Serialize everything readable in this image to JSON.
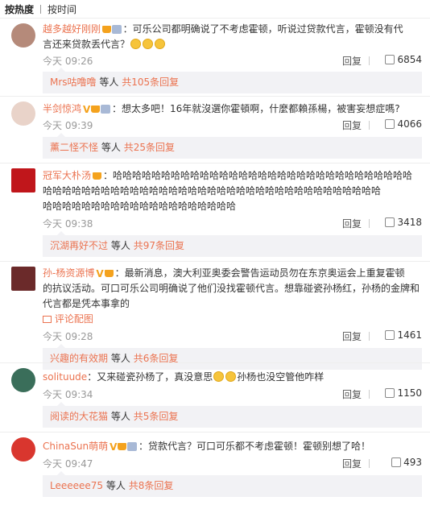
{
  "tabs": [
    "按热度",
    "按时间"
  ],
  "ui": {
    "reply": "回复",
    "mid": "等人",
    "gong": "共",
    "reply_count_suffix": "条回复"
  },
  "comments": [
    {
      "user": "越多越好刚刚",
      "text_a": "：可乐公司都明确说了不考虑霍顿，听说过贷款代言，霍顿没有代",
      "text_b": "言还来贷款丢代言？",
      "time": "今天 09:26",
      "likes": "6854",
      "sub_name": "Mrs咕噜噜",
      "sub_count": "105"
    },
    {
      "user": "半剑惊鸿",
      "text_a": "：想太多吧！16年就沒選你霍頓啊，什麼都賴孫楊，被害妄想症嗎?",
      "time": "今天 09:39",
      "likes": "4066",
      "sub_name": "薰二怪不怪",
      "sub_count": "25"
    },
    {
      "user": "冠军大朴汤",
      "text_a": "：哈哈哈哈哈哈哈哈哈哈哈哈哈哈哈哈哈哈哈哈哈哈哈哈哈哈哈哈哈哈哈",
      "text_b": "哈哈哈哈哈哈哈哈哈哈哈哈哈哈哈哈哈哈哈哈哈哈哈哈哈哈哈哈哈哈哈哈哈哈哈",
      "text_c": "哈哈哈哈哈哈哈哈哈哈哈哈哈哈哈哈哈哈哈哈",
      "time": "今天 09:38",
      "likes": "3418",
      "sub_name": "沉湖再好不过",
      "sub_count": "97"
    },
    {
      "user": "孙-杨资源博",
      "text_a": "：最新消息，澳大利亚奥委会警告运动员勿在东京奥运会上重复霍顿",
      "text_b": "的抗议活动。可口可乐公司明确说了他们没找霍顿代言。想靠碰瓷孙杨红，孙杨的金牌和",
      "text_c": "代言都是凭本事拿的",
      "pic": "评论配图",
      "time": "今天 09:28",
      "likes": "1461",
      "sub_name": "兴趣的有效期",
      "sub_count": "6"
    },
    {
      "user": "solituude",
      "text_a": "：又来碰瓷孙杨了，真没意思",
      "text_a2": "孙杨也没空管他咋样",
      "time": "今天 09:34",
      "likes": "1150",
      "sub_name": "阅读的大花猫",
      "sub_count": "5"
    },
    {
      "user": "ChinaSun萌萌",
      "text_a": "：贷款代言？可口可乐都不考虑霍顿！霍顿别想了哈！",
      "time": "今天 09:47",
      "likes": "493",
      "sub_name": "Leeeeee75",
      "sub_count": "8"
    }
  ],
  "colors": {
    "username": "#eb7350",
    "accent": "#f4a21d"
  }
}
